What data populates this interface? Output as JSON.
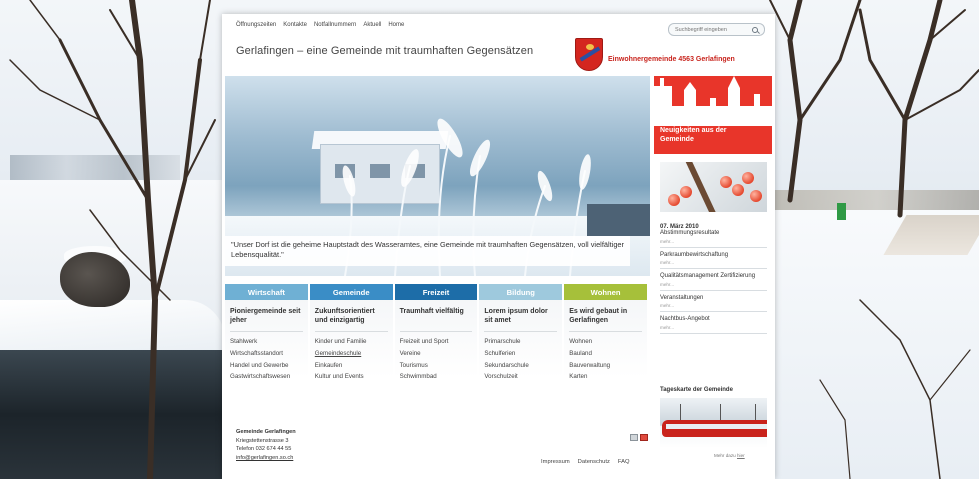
{
  "top_nav": [
    "Öffnungszeiten",
    "Kontakte",
    "Notfallnummern",
    "Aktuell",
    "Home"
  ],
  "search": {
    "placeholder": "Suchbegriff eingeben"
  },
  "site_title": "Gerlafingen – eine Gemeinde mit traumhaften Gegensätzen",
  "org_name": "Einwohnergemeinde 4563 Gerlafingen",
  "hero_quote": "\"Unser Dorf ist die geheime Hauptstadt des Wasseramtes, eine Gemeinde mit traumhaften Gegensätzen, voll vielfältiger Lebensqualität.\"",
  "news": {
    "title": "Neuigkeiten aus der Gemeinde",
    "items": [
      {
        "date": "07. März 2010",
        "headline": "Abstimmungsresultate",
        "more": "mehr..."
      },
      {
        "date": "",
        "headline": "Parkraumbewirtschaftung",
        "more": "mehr..."
      },
      {
        "date": "",
        "headline": "Qualitätsmanagement Zertifizierung",
        "more": "mehr..."
      },
      {
        "date": "",
        "headline": "Veranstaltungen",
        "more": "mehr..."
      },
      {
        "date": "",
        "headline": "Nachtbus-Angebot",
        "more": "mehr..."
      }
    ],
    "map_title": "Tageskarte der Gemeinde",
    "map_link_prefix": "Mehr dazu",
    "map_link_label": "hier"
  },
  "colors": {
    "wirtschaft": "#6fb0d4",
    "gemeinde": "#3a8dc6",
    "freizeit": "#1d6da8",
    "bildung": "#9ec9dd",
    "wohnen": "#a6c03a",
    "brand_red": "#e8352a"
  },
  "categories": [
    {
      "key": "wirtschaft",
      "tab": "Wirtschaft",
      "heading": "Pioniergemeinde seit jeher",
      "links": [
        "Stahlwerk",
        "Wirtschaftsstandort",
        "Handel und Gewerbe",
        "Gastwirtschaftswesen"
      ]
    },
    {
      "key": "gemeinde",
      "tab": "Gemeinde",
      "heading": "Zukunftsorientiert und einzigartig",
      "links": [
        "Kinder und Familie",
        "Gemeindeschule",
        "Einkaufen",
        "Kultur und Events"
      ]
    },
    {
      "key": "freizeit",
      "tab": "Freizeit",
      "heading": "Traumhaft vielfältig",
      "links": [
        "Freizeit und Sport",
        "Vereine",
        "Tourismus",
        "Schwimmbad"
      ]
    },
    {
      "key": "bildung",
      "tab": "Bildung",
      "heading": "Lorem ipsum dolor sit amet",
      "links": [
        "Primarschule",
        "Schulferien",
        "Sekundarschule",
        "Vorschulzeit"
      ]
    },
    {
      "key": "wohnen",
      "tab": "Wohnen",
      "heading": "Es wird gebaut in Gerlafingen",
      "links": [
        "Wohnen",
        "Bauland",
        "Bauverwaltung",
        "Karten"
      ]
    }
  ],
  "footer": {
    "name": "Gemeinde Gerlafingen",
    "street": "Kriegstettenstrasse 3",
    "phone": "Telefon 032 674 44 55",
    "email": "info@gerlafingen.so.ch",
    "links": [
      "Impressum",
      "Datenschutz",
      "FAQ"
    ]
  },
  "icons": {
    "search": "search-icon",
    "print": "print-icon",
    "pdf": "pdf-icon",
    "crest": "municipal-crest-icon"
  }
}
